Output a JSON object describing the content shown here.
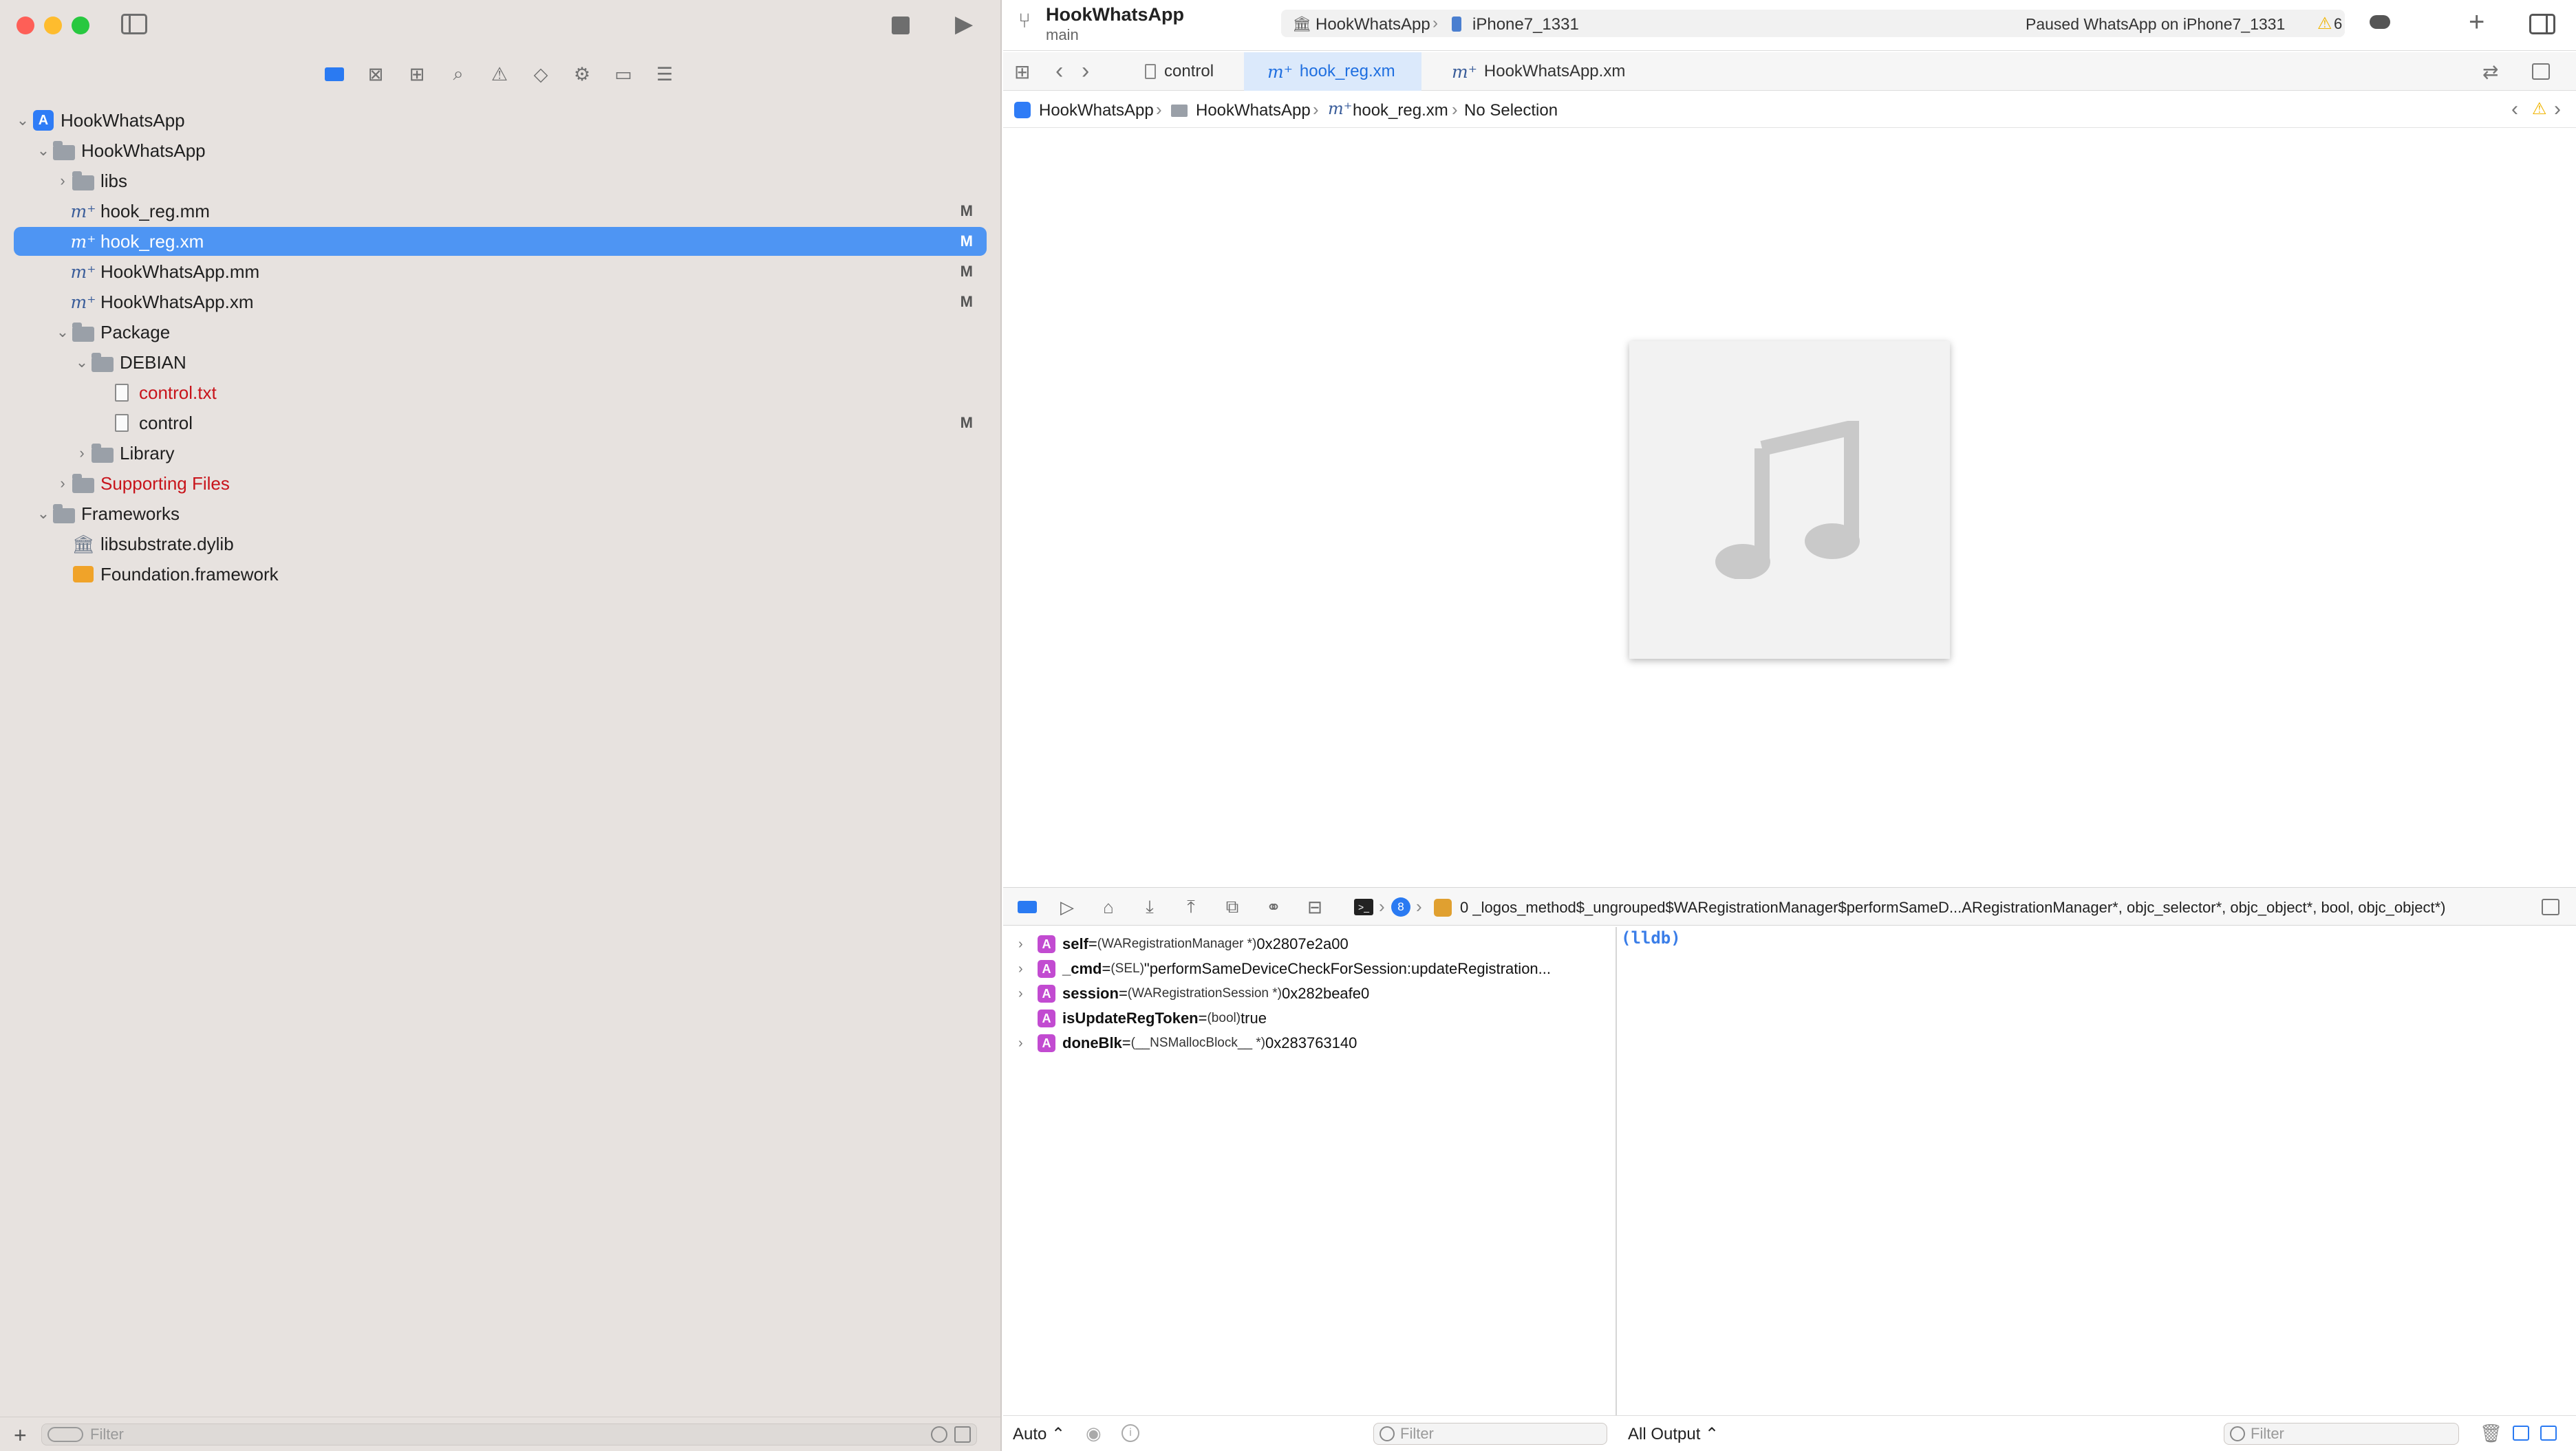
{
  "window": {
    "project_title": "HookWhatsApp",
    "branch": "main",
    "scheme": "HookWhatsApp",
    "device": "iPhone7_1331",
    "status": "Paused WhatsApp on iPhone7_1331",
    "warning_count": "6"
  },
  "navigator": {
    "items": [
      {
        "label": "HookWhatsApp"
      },
      {
        "label": "HookWhatsApp"
      },
      {
        "label": "libs"
      },
      {
        "label": "hook_reg.mm",
        "badge": "M"
      },
      {
        "label": "hook_reg.xm",
        "badge": "M"
      },
      {
        "label": "HookWhatsApp.mm",
        "badge": "M"
      },
      {
        "label": "HookWhatsApp.xm",
        "badge": "M"
      },
      {
        "label": "Package"
      },
      {
        "label": "DEBIAN"
      },
      {
        "label": "control.txt"
      },
      {
        "label": "control",
        "badge": "M"
      },
      {
        "label": "Library"
      },
      {
        "label": "Supporting Files"
      },
      {
        "label": "Frameworks"
      },
      {
        "label": "libsubstrate.dylib"
      },
      {
        "label": "Foundation.framework"
      }
    ],
    "filter_placeholder": "Filter"
  },
  "tabs": [
    {
      "label": "control"
    },
    {
      "label": "hook_reg.xm"
    },
    {
      "label": "HookWhatsApp.xm"
    }
  ],
  "jumpbar": [
    "HookWhatsApp",
    "HookWhatsApp",
    "hook_reg.xm",
    "No Selection"
  ],
  "debug": {
    "thread_badge": "8",
    "frame": "0 _logos_method$_ungrouped$WARegistrationManager$performSameD...ARegistrationManager*, objc_selector*, objc_object*, bool, objc_object*)"
  },
  "variables": [
    {
      "name": "self",
      "eq": " = ",
      "type": "(WARegistrationManager *)",
      "value": " 0x2807e2a00"
    },
    {
      "name": "_cmd",
      "eq": " = ",
      "type": "(SEL)",
      "value": " \"performSameDeviceCheckForSession:updateRegistration..."
    },
    {
      "name": "session",
      "eq": " = ",
      "type": "(WARegistrationSession *)",
      "value": " 0x282beafe0"
    },
    {
      "name": "isUpdateRegToken",
      "eq": " = ",
      "type": "(bool)",
      "value": " true"
    },
    {
      "name": "doneBlk",
      "eq": " = ",
      "type": "(__NSMallocBlock__ *)",
      "value": " 0x283763140"
    }
  ],
  "console": {
    "prompt": "(lldb)"
  },
  "footer": {
    "auto_label": "Auto ⌃",
    "vars_filter_placeholder": "Filter",
    "output_label": "All Output ⌃",
    "console_filter_placeholder": "Filter"
  },
  "colors": {
    "selection": "#4e95f3",
    "accent": "#1f6fe0",
    "error_red": "#c8141b",
    "warning": "#f0b400",
    "var_badge": "#c24bd1"
  }
}
